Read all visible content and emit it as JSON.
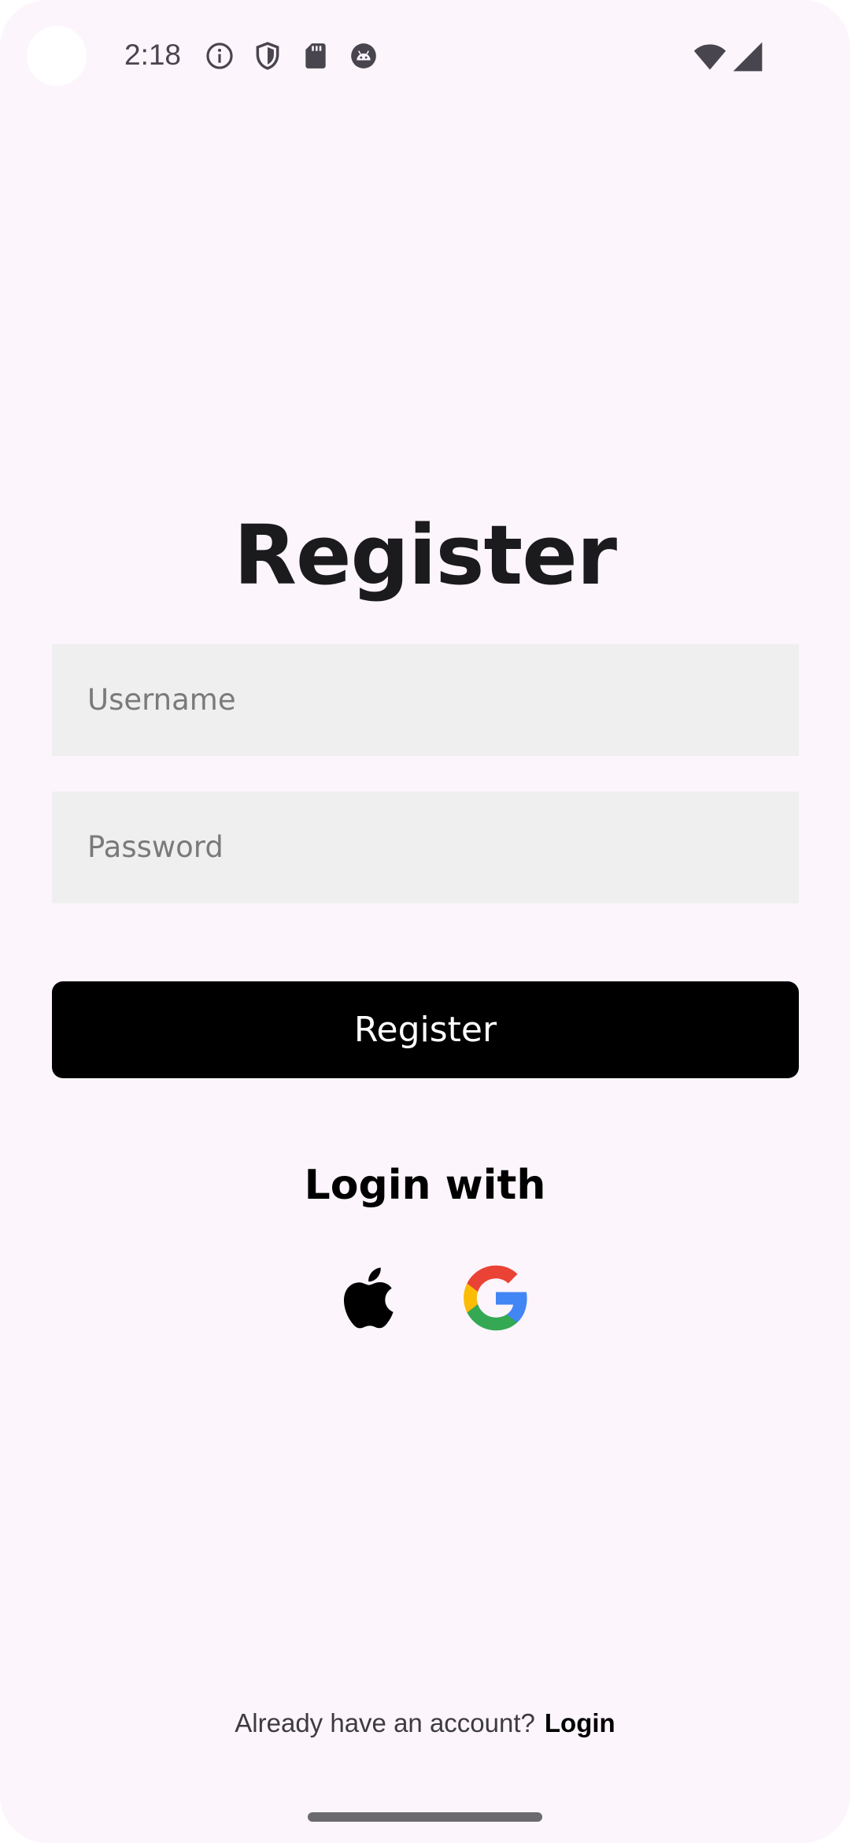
{
  "status_bar": {
    "time": "2:18",
    "icons": [
      "info-icon",
      "shield-icon",
      "sd-card-icon",
      "android-icon",
      "wifi-icon",
      "signal-icon"
    ]
  },
  "page": {
    "title": "Register"
  },
  "form": {
    "username": {
      "value": "",
      "placeholder": "Username"
    },
    "password": {
      "value": "",
      "placeholder": "Password"
    },
    "submit_label": "Register"
  },
  "social": {
    "heading": "Login with",
    "providers": [
      "apple-icon",
      "google-icon"
    ]
  },
  "footer": {
    "prompt": "Already have an account?",
    "link": "Login"
  },
  "colors": {
    "background": "#fcf5fb",
    "input_background": "#efefef",
    "button_background": "#000000",
    "button_text": "#ffffff"
  }
}
